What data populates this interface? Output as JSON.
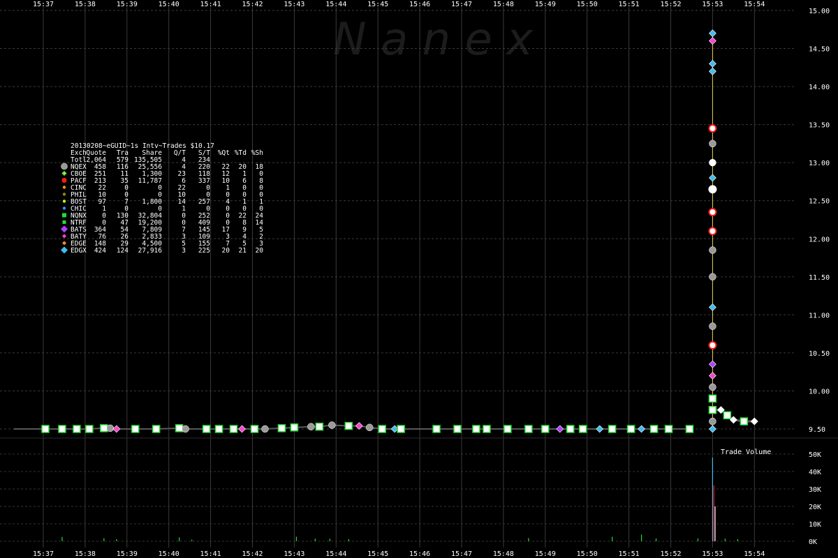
{
  "chart_data": {
    "type": "scatter",
    "watermark": "N a n e x",
    "header": "20130208~eGUID~1s Intv~Trades $10.17",
    "volume_label": "Trade Volume",
    "x_ticks": [
      "15:37",
      "15:38",
      "15:39",
      "15:40",
      "15:41",
      "15:42",
      "15:43",
      "15:44",
      "15:45",
      "15:46",
      "15:47",
      "15:48",
      "15:49",
      "15:50",
      "15:51",
      "15:52",
      "15:53",
      "15:54"
    ],
    "y_ticks": [
      "9.50",
      "10.00",
      "10.50",
      "11.00",
      "11.50",
      "12.00",
      "12.50",
      "13.00",
      "13.50",
      "14.00",
      "14.50",
      "15.00"
    ],
    "ylim": [
      9.5,
      15.0
    ],
    "volume_ticks": [
      "0K",
      "10K",
      "20K",
      "30K",
      "40K",
      "50K"
    ],
    "volume_ylim": [
      0,
      50000
    ],
    "table_columns": [
      "Exch",
      "Quote",
      "Tra",
      "Share",
      "Q/T",
      "S/T",
      "%Qt",
      "%Td",
      "%Sh"
    ],
    "table_total": [
      "Totl",
      "2,064",
      "579",
      "135,505",
      "4",
      "234",
      "",
      "",
      ""
    ],
    "table_rows": [
      {
        "exch": "NQEX",
        "cells": [
          "458",
          "116",
          "25,556",
          "4",
          "220",
          "22",
          "20",
          "18"
        ],
        "color": "#9a9a9a",
        "marker": "octagon"
      },
      {
        "exch": "CBOE",
        "cells": [
          "251",
          "11",
          "1,300",
          "23",
          "118",
          "12",
          "1",
          "0"
        ],
        "color": "#7cff3a",
        "marker": "plus"
      },
      {
        "exch": "PACF",
        "cells": [
          "213",
          "35",
          "11,787",
          "6",
          "337",
          "10",
          "6",
          "8"
        ],
        "color": "#ff1a1a",
        "marker": "circle"
      },
      {
        "exch": "CINC",
        "cells": [
          "22",
          "0",
          "0",
          "22",
          "0",
          "1",
          "0",
          "0"
        ],
        "color": "#ff9a00",
        "marker": "dot"
      },
      {
        "exch": "PHIL",
        "cells": [
          "10",
          "0",
          "0",
          "10",
          "0",
          "0",
          "0",
          "0"
        ],
        "color": "#8a8a1a",
        "marker": "dot"
      },
      {
        "exch": "BOST",
        "cells": [
          "97",
          "7",
          "1,800",
          "14",
          "257",
          "4",
          "1",
          "1"
        ],
        "color": "#c8ff00",
        "marker": "dot"
      },
      {
        "exch": "CHIC",
        "cells": [
          "1",
          "0",
          "0",
          "1",
          "0",
          "0",
          "0",
          "0"
        ],
        "color": "#3a8aff",
        "marker": "dot"
      },
      {
        "exch": "NQNX",
        "cells": [
          "0",
          "130",
          "32,804",
          "0",
          "252",
          "0",
          "22",
          "24"
        ],
        "color": "#22dd33",
        "marker": "square"
      },
      {
        "exch": "NTRF",
        "cells": [
          "0",
          "47",
          "19,200",
          "0",
          "409",
          "0",
          "8",
          "14"
        ],
        "color": "#22dd33",
        "marker": "square-small"
      },
      {
        "exch": "BATS",
        "cells": [
          "364",
          "54",
          "7,809",
          "7",
          "145",
          "17",
          "9",
          "5"
        ],
        "color": "#b040ff",
        "marker": "diamond"
      },
      {
        "exch": "BATY",
        "cells": [
          "76",
          "26",
          "2,833",
          "3",
          "109",
          "3",
          "4",
          "2"
        ],
        "color": "#ff44cc",
        "marker": "diamond-small"
      },
      {
        "exch": "EDGE",
        "cells": [
          "148",
          "29",
          "4,500",
          "5",
          "155",
          "7",
          "5",
          "3"
        ],
        "color": "#ff8a20",
        "marker": "diamond-small"
      },
      {
        "exch": "EDGX",
        "cells": [
          "424",
          "124",
          "27,916",
          "3",
          "225",
          "20",
          "21",
          "20"
        ],
        "color": "#44bbee",
        "marker": "diamond"
      }
    ],
    "trades": [
      {
        "t": 37.05,
        "p": 9.5,
        "c": "#22dd33",
        "m": "sq"
      },
      {
        "t": 37.45,
        "p": 9.5,
        "c": "#22dd33",
        "m": "sq"
      },
      {
        "t": 37.8,
        "p": 9.5,
        "c": "#22dd33",
        "m": "sq"
      },
      {
        "t": 38.1,
        "p": 9.5,
        "c": "#22dd33",
        "m": "sq"
      },
      {
        "t": 38.45,
        "p": 9.51,
        "c": "#22dd33",
        "m": "sq"
      },
      {
        "t": 38.6,
        "p": 9.51,
        "c": "#9a9a9a",
        "m": "oct"
      },
      {
        "t": 38.75,
        "p": 9.5,
        "c": "#ff44cc",
        "m": "dia"
      },
      {
        "t": 39.2,
        "p": 9.5,
        "c": "#22dd33",
        "m": "sq"
      },
      {
        "t": 39.7,
        "p": 9.5,
        "c": "#22dd33",
        "m": "sq"
      },
      {
        "t": 40.25,
        "p": 9.51,
        "c": "#22dd33",
        "m": "sq"
      },
      {
        "t": 40.4,
        "p": 9.5,
        "c": "#9a9a9a",
        "m": "oct"
      },
      {
        "t": 40.9,
        "p": 9.5,
        "c": "#22dd33",
        "m": "sq"
      },
      {
        "t": 41.2,
        "p": 9.5,
        "c": "#22dd33",
        "m": "sq"
      },
      {
        "t": 41.55,
        "p": 9.5,
        "c": "#22dd33",
        "m": "sq"
      },
      {
        "t": 41.75,
        "p": 9.5,
        "c": "#ff44cc",
        "m": "dia"
      },
      {
        "t": 42.05,
        "p": 9.5,
        "c": "#22dd33",
        "m": "sq"
      },
      {
        "t": 42.3,
        "p": 9.5,
        "c": "#9a9a9a",
        "m": "oct"
      },
      {
        "t": 42.7,
        "p": 9.51,
        "c": "#22dd33",
        "m": "sq"
      },
      {
        "t": 43.0,
        "p": 9.52,
        "c": "#22dd33",
        "m": "sq"
      },
      {
        "t": 43.4,
        "p": 9.53,
        "c": "#9a9a9a",
        "m": "oct"
      },
      {
        "t": 43.6,
        "p": 9.53,
        "c": "#22dd33",
        "m": "sq"
      },
      {
        "t": 43.9,
        "p": 9.55,
        "c": "#9a9a9a",
        "m": "oct"
      },
      {
        "t": 44.3,
        "p": 9.54,
        "c": "#22dd33",
        "m": "sq"
      },
      {
        "t": 44.55,
        "p": 9.54,
        "c": "#ff44cc",
        "m": "dia"
      },
      {
        "t": 44.8,
        "p": 9.52,
        "c": "#9a9a9a",
        "m": "oct"
      },
      {
        "t": 45.1,
        "p": 9.5,
        "c": "#22dd33",
        "m": "sq"
      },
      {
        "t": 45.4,
        "p": 9.5,
        "c": "#44bbee",
        "m": "dia"
      },
      {
        "t": 45.55,
        "p": 9.5,
        "c": "#22dd33",
        "m": "sq"
      },
      {
        "t": 46.4,
        "p": 9.5,
        "c": "#22dd33",
        "m": "sq"
      },
      {
        "t": 46.9,
        "p": 9.5,
        "c": "#22dd33",
        "m": "sq"
      },
      {
        "t": 47.35,
        "p": 9.5,
        "c": "#22dd33",
        "m": "sq"
      },
      {
        "t": 47.6,
        "p": 9.5,
        "c": "#22dd33",
        "m": "sq"
      },
      {
        "t": 48.1,
        "p": 9.5,
        "c": "#22dd33",
        "m": "sq"
      },
      {
        "t": 48.6,
        "p": 9.5,
        "c": "#22dd33",
        "m": "sq"
      },
      {
        "t": 49.0,
        "p": 9.5,
        "c": "#22dd33",
        "m": "sq"
      },
      {
        "t": 49.35,
        "p": 9.5,
        "c": "#b040ff",
        "m": "dia"
      },
      {
        "t": 49.6,
        "p": 9.5,
        "c": "#22dd33",
        "m": "sq"
      },
      {
        "t": 49.9,
        "p": 9.5,
        "c": "#22dd33",
        "m": "sq"
      },
      {
        "t": 50.3,
        "p": 9.5,
        "c": "#44bbee",
        "m": "dia"
      },
      {
        "t": 50.6,
        "p": 9.5,
        "c": "#22dd33",
        "m": "sq"
      },
      {
        "t": 51.05,
        "p": 9.5,
        "c": "#22dd33",
        "m": "sq"
      },
      {
        "t": 51.3,
        "p": 9.5,
        "c": "#44bbee",
        "m": "dia"
      },
      {
        "t": 51.6,
        "p": 9.5,
        "c": "#22dd33",
        "m": "sq"
      },
      {
        "t": 51.95,
        "p": 9.5,
        "c": "#22dd33",
        "m": "sq"
      },
      {
        "t": 52.45,
        "p": 9.5,
        "c": "#22dd33",
        "m": "sq"
      },
      {
        "t": 53.0,
        "p": 9.5,
        "c": "#44bbee",
        "m": "dia"
      },
      {
        "t": 53.0,
        "p": 9.6,
        "c": "#9a9a9a",
        "m": "oct"
      },
      {
        "t": 53.0,
        "p": 9.75,
        "c": "#22dd33",
        "m": "sq"
      },
      {
        "t": 53.0,
        "p": 9.9,
        "c": "#22dd33",
        "m": "sq"
      },
      {
        "t": 53.0,
        "p": 10.05,
        "c": "#9a9a9a",
        "m": "oct"
      },
      {
        "t": 53.0,
        "p": 10.2,
        "c": "#ff44cc",
        "m": "dia"
      },
      {
        "t": 53.0,
        "p": 10.35,
        "c": "#b040ff",
        "m": "dia"
      },
      {
        "t": 53.0,
        "p": 10.6,
        "c": "#ff1a1a",
        "m": "cir"
      },
      {
        "t": 53.0,
        "p": 10.85,
        "c": "#9a9a9a",
        "m": "oct"
      },
      {
        "t": 53.0,
        "p": 11.1,
        "c": "#44bbee",
        "m": "dia"
      },
      {
        "t": 53.0,
        "p": 11.5,
        "c": "#9a9a9a",
        "m": "oct"
      },
      {
        "t": 53.0,
        "p": 11.85,
        "c": "#9a9a9a",
        "m": "oct"
      },
      {
        "t": 53.0,
        "p": 12.1,
        "c": "#ff1a1a",
        "m": "cir"
      },
      {
        "t": 53.0,
        "p": 12.35,
        "c": "#ff1a1a",
        "m": "cir"
      },
      {
        "t": 53.0,
        "p": 12.65,
        "c": "#ffffff",
        "m": "cir"
      },
      {
        "t": 53.0,
        "p": 12.8,
        "c": "#44bbee",
        "m": "dia"
      },
      {
        "t": 53.0,
        "p": 13.0,
        "c": "#ffffff",
        "m": "oct"
      },
      {
        "t": 53.0,
        "p": 13.25,
        "c": "#9a9a9a",
        "m": "oct"
      },
      {
        "t": 53.0,
        "p": 13.45,
        "c": "#ff1a1a",
        "m": "cir"
      },
      {
        "t": 53.0,
        "p": 14.2,
        "c": "#44bbee",
        "m": "dia"
      },
      {
        "t": 53.0,
        "p": 14.3,
        "c": "#44bbee",
        "m": "dia"
      },
      {
        "t": 53.0,
        "p": 14.6,
        "c": "#ff44cc",
        "m": "dia"
      },
      {
        "t": 53.0,
        "p": 14.7,
        "c": "#44bbee",
        "m": "dia"
      },
      {
        "t": 53.2,
        "p": 9.75,
        "c": "#ffffff",
        "m": "dia"
      },
      {
        "t": 53.35,
        "p": 9.68,
        "c": "#22dd33",
        "m": "sq"
      },
      {
        "t": 53.5,
        "p": 9.62,
        "c": "#ffffff",
        "m": "dia"
      },
      {
        "t": 53.75,
        "p": 9.6,
        "c": "#22dd33",
        "m": "sq"
      },
      {
        "t": 54.0,
        "p": 9.6,
        "c": "#ffffff",
        "m": "dia"
      }
    ],
    "volume_bars": [
      {
        "t": 37.45,
        "v": 2500,
        "c": "#22dd33"
      },
      {
        "t": 38.45,
        "v": 1800,
        "c": "#22dd33"
      },
      {
        "t": 38.75,
        "v": 1200,
        "c": "#22dd33"
      },
      {
        "t": 40.25,
        "v": 2200,
        "c": "#22dd33"
      },
      {
        "t": 40.55,
        "v": 900,
        "c": "#22dd33"
      },
      {
        "t": 43.05,
        "v": 2600,
        "c": "#22dd33"
      },
      {
        "t": 43.5,
        "v": 1500,
        "c": "#22dd33"
      },
      {
        "t": 43.85,
        "v": 1500,
        "c": "#22dd33"
      },
      {
        "t": 44.3,
        "v": 1200,
        "c": "#22dd33"
      },
      {
        "t": 48.6,
        "v": 1800,
        "c": "#22dd33"
      },
      {
        "t": 50.6,
        "v": 2600,
        "c": "#22dd33"
      },
      {
        "t": 51.3,
        "v": 3800,
        "c": "#22dd33"
      },
      {
        "t": 51.65,
        "v": 1600,
        "c": "#22dd33"
      },
      {
        "t": 52.65,
        "v": 1600,
        "c": "#22dd33"
      },
      {
        "t": 53.0,
        "v": 48000,
        "c": "#44bbee"
      },
      {
        "t": 53.03,
        "v": 32000,
        "c": "#ff1a1a"
      },
      {
        "t": 53.06,
        "v": 20000,
        "c": "#ffffff"
      },
      {
        "t": 53.3,
        "v": 1500,
        "c": "#22dd33"
      },
      {
        "t": 53.6,
        "v": 1200,
        "c": "#22dd33"
      }
    ]
  }
}
